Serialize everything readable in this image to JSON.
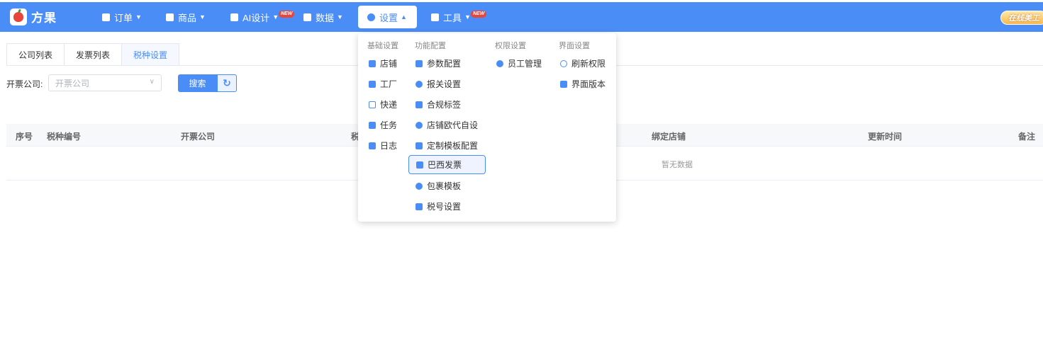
{
  "app": {
    "logo_text": "方果",
    "online_label": "在线美工"
  },
  "nav": [
    {
      "label": "订单",
      "icon": "clipboard-icon"
    },
    {
      "label": "商品",
      "icon": "bag-icon"
    },
    {
      "label": "AI设计",
      "icon": "ai-icon",
      "badge": "NEW"
    },
    {
      "label": "数据",
      "icon": "chart-icon"
    },
    {
      "label": "设置",
      "icon": "gear-icon",
      "active": true
    },
    {
      "label": "工具",
      "icon": "cube-icon",
      "badge": "NEW"
    }
  ],
  "tabs": [
    "公司列表",
    "发票列表",
    "税种设置"
  ],
  "active_tab": "税种设置",
  "filter": {
    "label": "开票公司:",
    "placeholder": "开票公司",
    "search_label": "搜索",
    "refresh_icon": "refresh-icon"
  },
  "table": {
    "headers": [
      "序号",
      "税种编号",
      "开票公司",
      "税",
      "绑定店铺",
      "更新时间",
      "备注"
    ],
    "empty_text": "暂无数据"
  },
  "menu": {
    "basic": {
      "title": "基础设置",
      "items": [
        "店铺",
        "工厂",
        "快递",
        "任务",
        "日志"
      ]
    },
    "function": {
      "title": "功能配置",
      "items": [
        "参数配置",
        "报关设置",
        "合规标签",
        "店铺欧代自设",
        "定制模板配置",
        "巴西发票",
        "包裹模板",
        "税号设置"
      ]
    },
    "permission": {
      "title": "权限设置",
      "items": [
        "员工管理"
      ]
    },
    "ui": {
      "title": "界面设置",
      "items": [
        "刷新权限",
        "界面版本"
      ]
    },
    "selected_item": "巴西发票"
  },
  "colors": {
    "accent": "#4a8df7",
    "badge": "#e8463a"
  }
}
